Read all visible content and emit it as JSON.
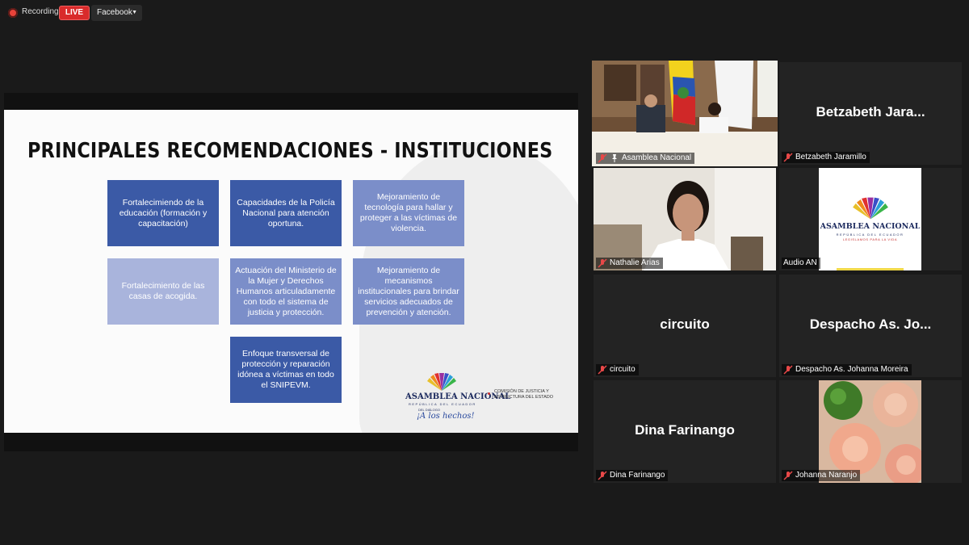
{
  "topbar": {
    "recording_label": "Recording",
    "live_label": "LIVE",
    "stream_target": "Facebook"
  },
  "slide": {
    "title": "PRINCIPALES RECOMENDACIONES - INSTITUCIONES",
    "boxes": [
      "Fortalecimiendo de la educación (formación y capacitación)",
      "Capacidades de la Policía Nacional para atención oportuna.",
      "Mejoramiento de tecnología para hallar y proteger a las víctimas de violencia.",
      "Fortalecimiento de las casas de acogida.",
      "Actuación del Ministerio de la Mujer y Derechos Humanos articuladamente con todo el sistema de justicia y protección.",
      "Mejoramiento de mecanismos institucionales para brindar servicios adecuados de prevención y atención.",
      "Enfoque transversal de protección y reparación idónea a víctimas en todo el SNIPEVM."
    ],
    "logo": {
      "name": "ASAMBLEA NACIONAL",
      "sub": "REPÚBLICA DEL ECUADOR",
      "dialogo": "DEL DIÁLOGO",
      "slogan": "¡A los hechos!",
      "commission_line1": "COMISIÓN DE JUSTICIA Y",
      "commission_line2": "ESTRUCTURA DEL ESTADO"
    }
  },
  "participants": [
    {
      "display": "",
      "tag": "Asamblea Nacional"
    },
    {
      "display": "Betzabeth  Jara...",
      "tag": "Betzabeth Jaramillo"
    },
    {
      "display": "",
      "tag": "Nathalie Arias"
    },
    {
      "display": "",
      "tag": "Audio AN"
    },
    {
      "display": "circuito",
      "tag": "circuito"
    },
    {
      "display": "Despacho  As.  Jo...",
      "tag": "Despacho As. Johanna Moreira"
    },
    {
      "display": "Dina Farinango",
      "tag": "Dina Farinango"
    },
    {
      "display": "",
      "tag": "Johanna Naranjo"
    }
  ],
  "audio_an_logo": {
    "name": "ASAMBLEA NACIONAL",
    "sub": "REPÚBLICA DEL ECUADOR",
    "slogan": "LEGISLAMOS PARA LA VIDA"
  },
  "colors": {
    "live": "#d92b2b",
    "active_speaker": "#d6e34a",
    "box_dark": "#3b5aa6",
    "box_mid": "#7b8ec9",
    "box_light": "#a9b4dc"
  }
}
